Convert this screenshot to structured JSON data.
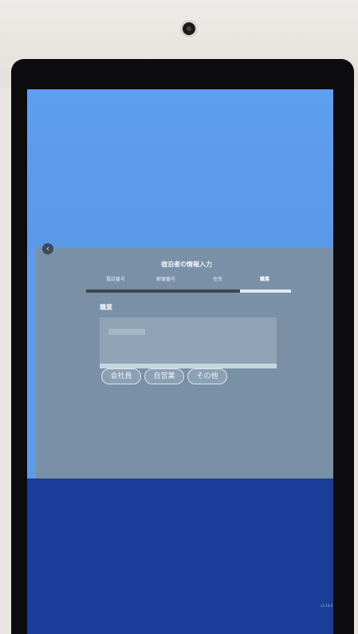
{
  "modal": {
    "title": "宿泊者の情報入力",
    "back_icon": "chevron-left-icon",
    "steps": [
      {
        "label": "電話番号",
        "active": false
      },
      {
        "label": "郵便番号",
        "active": false
      },
      {
        "label": "住所",
        "active": false
      },
      {
        "label": "職業",
        "active": true
      }
    ],
    "progress": 0.25,
    "section_label": "職業",
    "options": [
      "会社員",
      "自営業",
      "その他"
    ]
  },
  "footer": {
    "version": "v3.14.4"
  },
  "colors": {
    "screen_blue": "#5d9bea",
    "modal_gray": "#7990a7",
    "bottom_navy": "#193d98"
  }
}
